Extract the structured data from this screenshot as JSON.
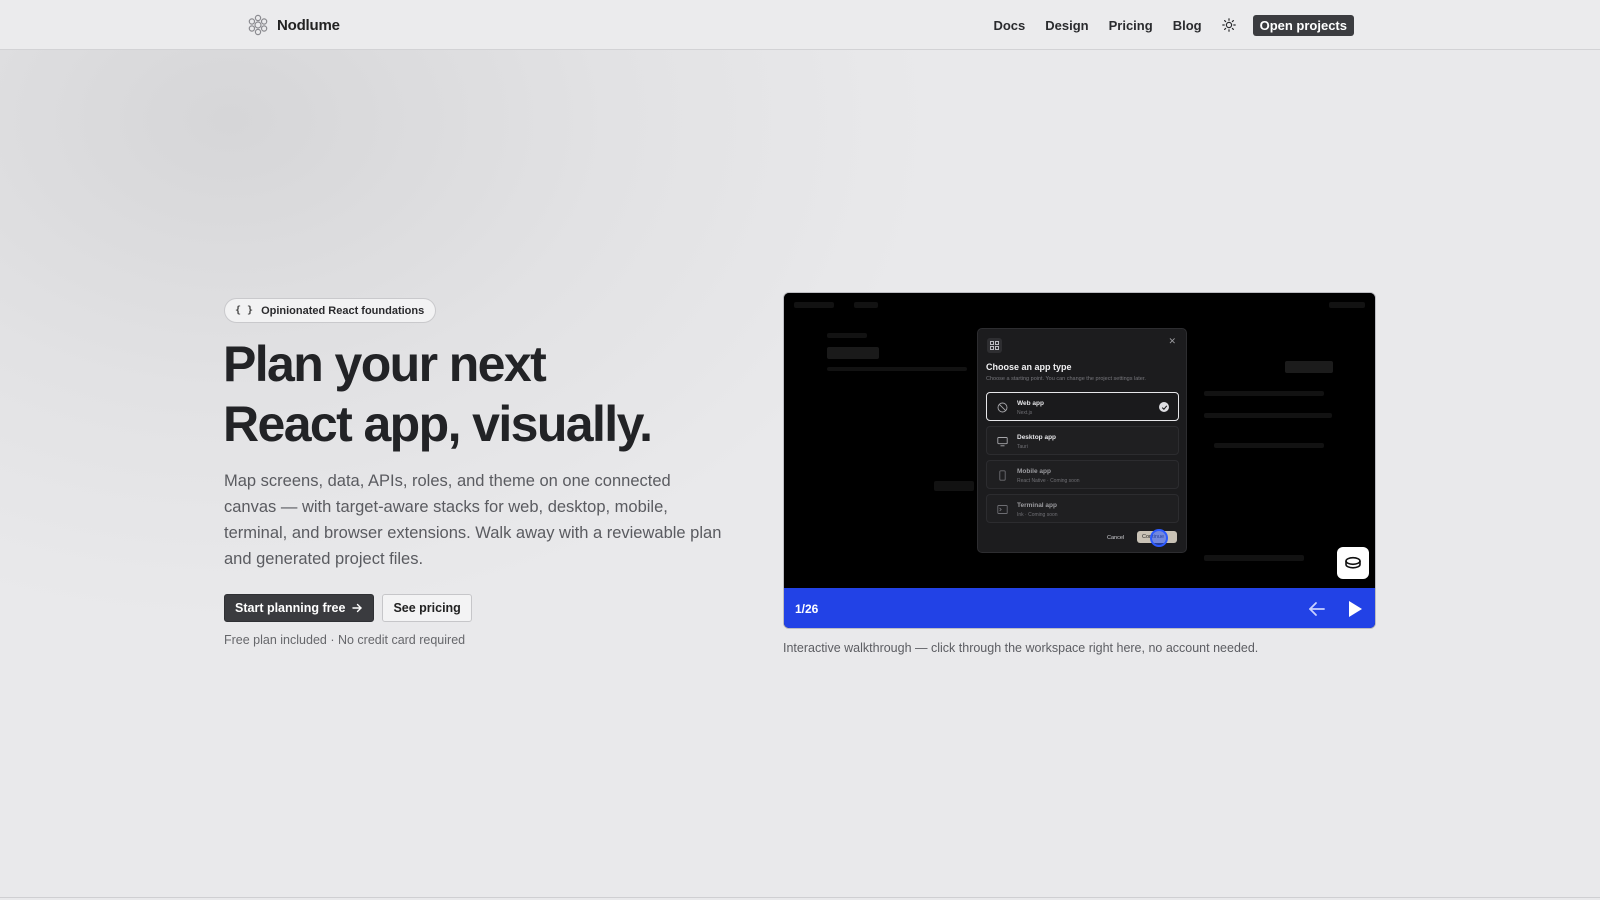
{
  "header": {
    "brand": "Nodlume",
    "nav": [
      {
        "label": "Docs"
      },
      {
        "label": "Design"
      },
      {
        "label": "Pricing"
      },
      {
        "label": "Blog"
      }
    ],
    "theme_icon": "sun-icon",
    "open_projects_label": "Open projects"
  },
  "hero": {
    "badge_icon": "{ }",
    "badge_label": "Opinionated React foundations",
    "title_line1": "Plan your next",
    "title_line2": "React app, visually.",
    "description": "Map screens, data, APIs, roles, and theme on one connected canvas — with target-aware stacks for web, desktop, mobile, terminal, and browser extensions. Walk away with a reviewable plan and generated project files.",
    "primary_cta": "Start planning free",
    "secondary_cta": "See pricing",
    "note": "Free plan included · No credit card required"
  },
  "walkthrough": {
    "modal": {
      "title": "Choose an app type",
      "subtitle": "Choose a starting point. You can change the project settings later.",
      "options": [
        {
          "label": "Web app",
          "desc": "Next.js",
          "icon": "globe-icon",
          "selected": true
        },
        {
          "label": "Desktop app",
          "desc": "Tauri",
          "icon": "monitor-icon",
          "selected": false
        },
        {
          "label": "Mobile app",
          "desc": "React Native · Coming soon",
          "icon": "phone-icon",
          "selected": false
        },
        {
          "label": "Terminal app",
          "desc": "Ink · Coming soon",
          "icon": "terminal-icon",
          "selected": false
        }
      ],
      "cancel_label": "Cancel",
      "continue_label": "Continue"
    },
    "counter": "1/26",
    "caption": "Interactive walkthrough — click through the workspace right here, no account needed."
  },
  "colors": {
    "accent_blue": "#2242e6",
    "dark_button": "#3a3b3f",
    "background": "#e9e9eb"
  }
}
